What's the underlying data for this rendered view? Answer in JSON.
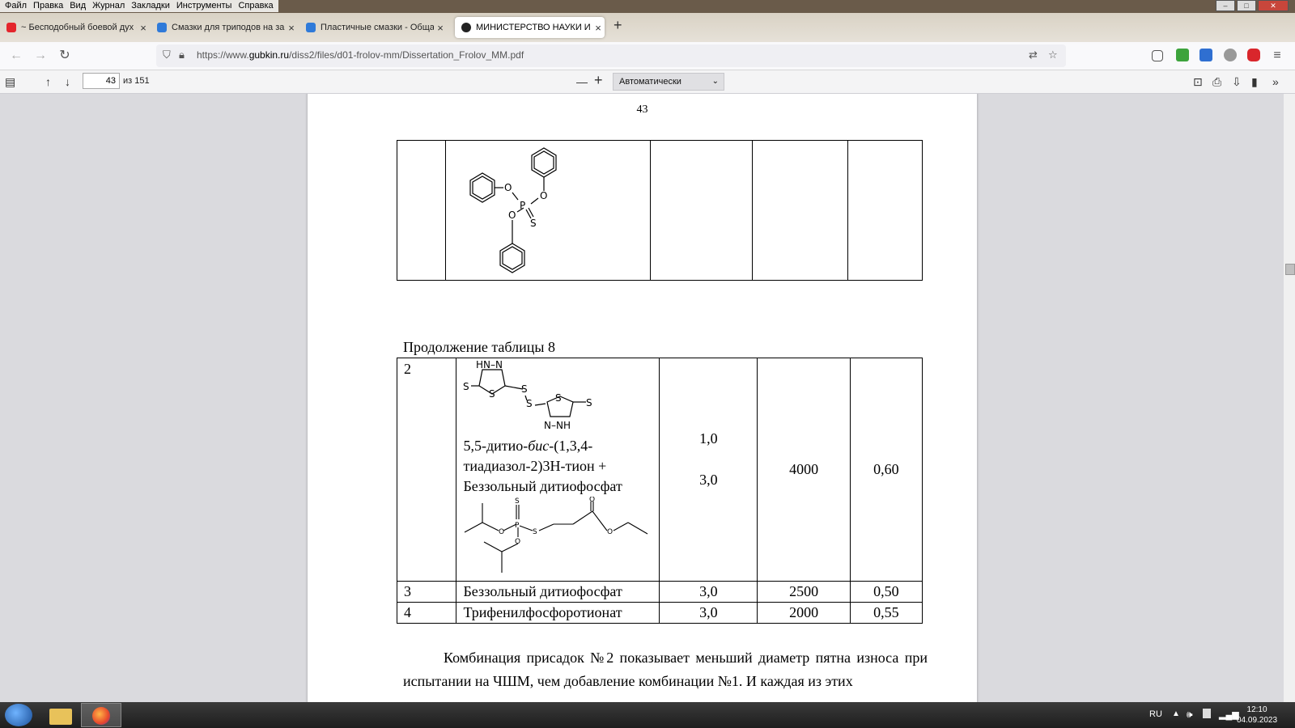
{
  "menu": {
    "items": [
      "Файл",
      "Правка",
      "Вид",
      "Журнал",
      "Закладки",
      "Инструменты",
      "Справка"
    ]
  },
  "tabs": [
    {
      "title": "~ Бесподобный боевой дух (З",
      "favicon_color": "#e4252c"
    },
    {
      "title": "Смазки для триподов на заме",
      "favicon_color": "#2f7ad9"
    },
    {
      "title": "Пластичные смазки - Общая",
      "favicon_color": "#2f7ad9"
    },
    {
      "title": "МИНИСТЕРСТВО НАУКИ И ВЫ",
      "favicon_color": "#222222",
      "active": true
    }
  ],
  "new_tab_label": "+",
  "url": {
    "prefix": "https://www.",
    "domain": "gubkin.ru",
    "path": "/diss2/files/d01-frolov-mm/Dissertation_Frolov_MM.pdf"
  },
  "pdf_toolbar": {
    "page_current": "43",
    "page_count": "из 151",
    "zoom": "Автоматически",
    "zoom_out": "—",
    "zoom_in": "+"
  },
  "document": {
    "page_number": "43",
    "caption": "Продолжение таблицы 8",
    "row2": {
      "num": "2",
      "name_part1": "5,5-дитио-",
      "name_italic": "бис",
      "name_part2": "-(1,3,4-тиадиазол-2)3Н-тион + Беззольный дитиофосфат",
      "conc1": "1,0",
      "conc2": "3,0",
      "load": "4000",
      "wear": "0,60"
    },
    "row3": {
      "num": "3",
      "name": "Беззольный дитиофосфат",
      "conc": "3,0",
      "load": "2500",
      "wear": "0,50"
    },
    "row4": {
      "num": "4",
      "name": "Трифенилфосфоротионат",
      "conc": "3,0",
      "load": "2000",
      "wear": "0,55"
    },
    "body_text": "Комбинация присадок №2 показывает меньший диаметр пятна износа при испытании на ЧШМ, чем добавление комбинации №1. И каждая из этих",
    "chem_labels": {
      "tpp": {
        "O1": "O",
        "O2": "O",
        "O3": "O",
        "P": "P",
        "S": "S"
      },
      "dmtd": {
        "HN_N": "HN–N",
        "N_NH": "N–NH",
        "S": "S"
      },
      "zdp": {
        "S": "S",
        "O": "O",
        "P": "P"
      }
    }
  },
  "taskbar": {
    "lang": "RU",
    "time": "12:10",
    "date": "04.09.2023"
  }
}
